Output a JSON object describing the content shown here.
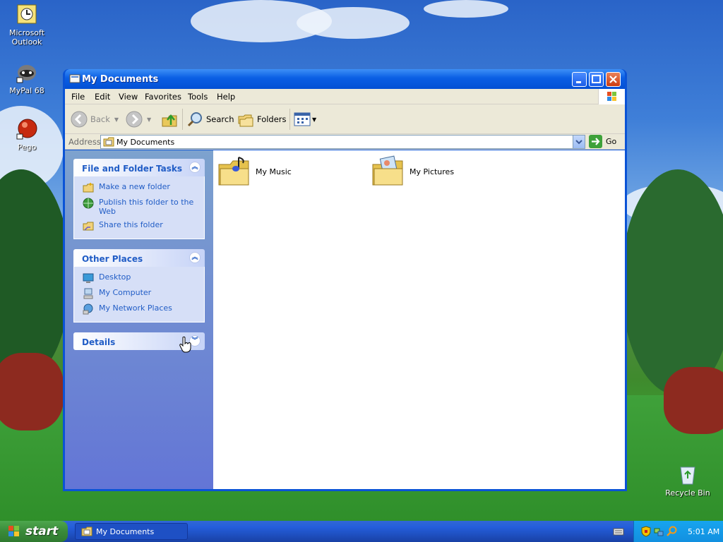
{
  "desktop": {
    "icons": [
      {
        "label": "Microsoft Outlook",
        "icon": "outlook-icon"
      },
      {
        "label": "MyPal 68",
        "icon": "raccoon-icon"
      },
      {
        "label": "Pego",
        "icon": "red-orb-icon"
      },
      {
        "label": "Recycle Bin",
        "icon": "recycle-bin-icon"
      }
    ]
  },
  "window": {
    "title": "My Documents",
    "menu": [
      "File",
      "Edit",
      "View",
      "Favorites",
      "Tools",
      "Help"
    ],
    "toolbar": {
      "back": "Back",
      "search": "Search",
      "folders": "Folders"
    },
    "address": {
      "label": "Address",
      "value": "My Documents",
      "go": "Go"
    }
  },
  "taskpane": {
    "file_tasks": {
      "title": "File and Folder Tasks",
      "items": [
        "Make a new folder",
        "Publish this folder to the Web",
        "Share this folder"
      ]
    },
    "other_places": {
      "title": "Other Places",
      "items": [
        "Desktop",
        "My Computer",
        "My Network Places"
      ]
    },
    "details": {
      "title": "Details"
    }
  },
  "files": [
    {
      "name": "My Music",
      "icon": "music-folder-icon"
    },
    {
      "name": "My Pictures",
      "icon": "pictures-folder-icon"
    }
  ],
  "taskbar": {
    "start": "start",
    "open_window": "My Documents",
    "clock": "5:01 AM"
  },
  "colors": {
    "title_blue": "#0a5ee4",
    "task_link": "#215dc6",
    "start_green": "#3a8a3a",
    "tray_blue": "#1290e0"
  }
}
